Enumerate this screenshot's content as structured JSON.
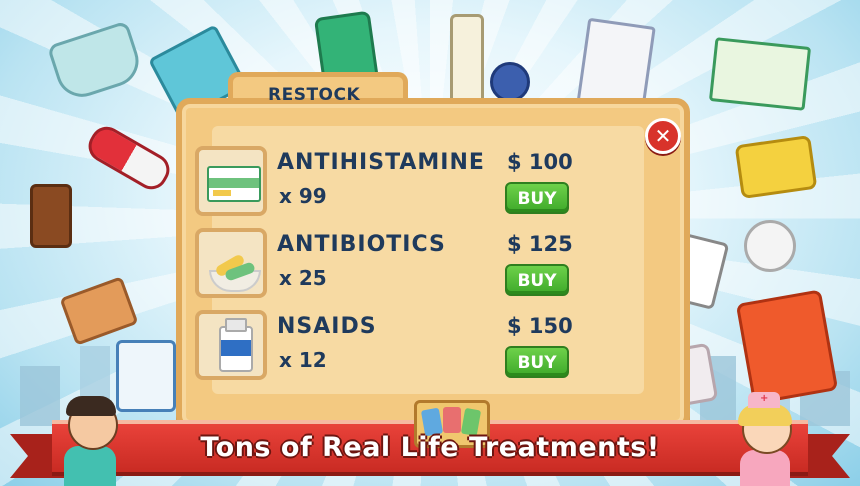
{
  "panel": {
    "title": "RESTOCK",
    "close_symbol": "✕"
  },
  "items": [
    {
      "name": "ANTIHISTAMINE",
      "qty": "x 99",
      "price": "$ 100",
      "buy_label": "BUY"
    },
    {
      "name": "ANTIBIOTICS",
      "qty": "x 25",
      "price": "$ 125",
      "buy_label": "BUY"
    },
    {
      "name": "NSAIDS",
      "qty": "x 12",
      "price": "$ 150",
      "buy_label": "BUY"
    }
  ],
  "banner": {
    "tagline": "Tons of Real Life Treatments!"
  },
  "colors": {
    "panel": "#f3c981",
    "panel_border": "#e0a95a",
    "text": "#1f3a5c",
    "buy_button": "#4fbf34",
    "close_button": "#d8332b",
    "ribbon": "#d9362e"
  }
}
